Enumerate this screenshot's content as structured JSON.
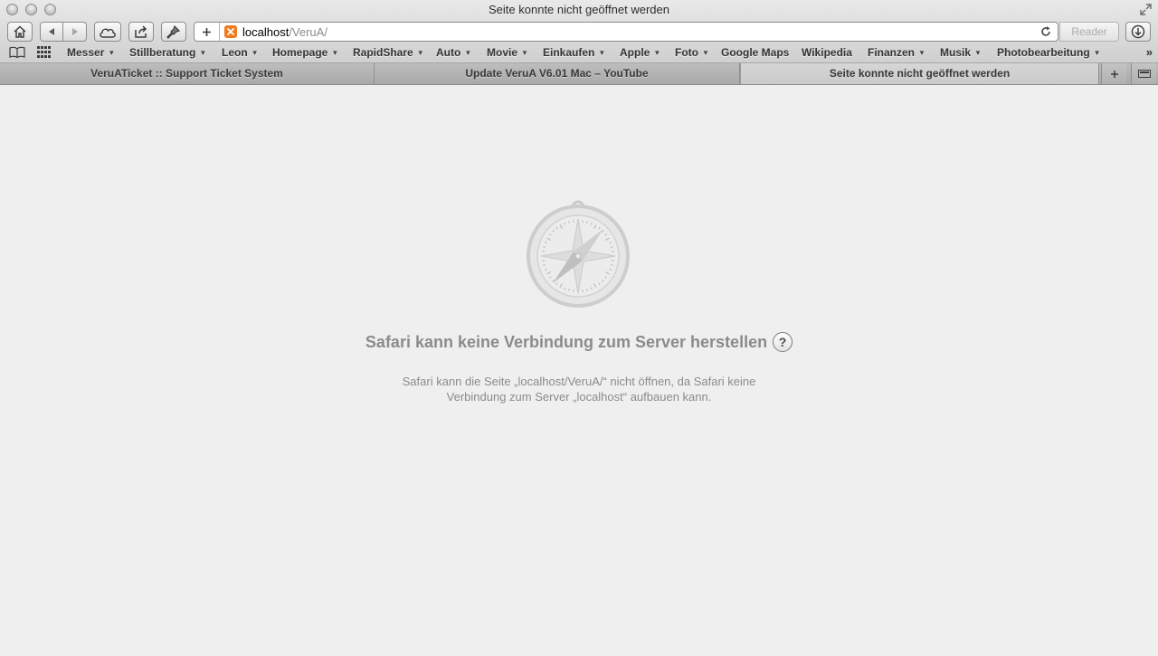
{
  "window": {
    "title": "Seite konnte nicht geöffnet werden"
  },
  "toolbar": {
    "url_host": "localhost",
    "url_path": "/VeruA/",
    "reader_label": "Reader"
  },
  "bookmarks": {
    "items": [
      {
        "label": "Messer",
        "menu": true
      },
      {
        "label": "Stillberatung",
        "menu": true
      },
      {
        "label": "Leon",
        "menu": true
      },
      {
        "label": "Homepage",
        "menu": true
      },
      {
        "label": "RapidShare",
        "menu": true
      },
      {
        "label": "Auto",
        "menu": true
      },
      {
        "label": "Movie",
        "menu": true
      },
      {
        "label": "Einkaufen",
        "menu": true
      },
      {
        "label": "Apple",
        "menu": true
      },
      {
        "label": "Foto",
        "menu": true
      },
      {
        "label": "Google Maps",
        "menu": false
      },
      {
        "label": "Wikipedia",
        "menu": false
      },
      {
        "label": "Finanzen",
        "menu": true
      },
      {
        "label": "Musik",
        "menu": true
      },
      {
        "label": "Photobearbeitung",
        "menu": true
      }
    ],
    "caret": "▼",
    "more": "»"
  },
  "tabs": [
    {
      "label": "VeruATicket :: Support Ticket System",
      "active": false
    },
    {
      "label": "Update VeruA V6.01 Mac – YouTube",
      "active": false
    },
    {
      "label": "Seite konnte nicht geöffnet werden",
      "active": true
    }
  ],
  "error": {
    "title": "Safari kann keine Verbindung zum Server herstellen",
    "help_label": "?",
    "message_line1": "Safari kann die Seite „localhost/VeruA/“ nicht öffnen, da Safari keine",
    "message_line2": "Verbindung zum Server „localhost“ aufbauen kann."
  },
  "colors": {
    "favicon": "#f07a1e",
    "content_bg": "#eeefee",
    "error_text": "#8b8b8b"
  },
  "icons": [
    "home-icon",
    "back-icon",
    "forward-icon",
    "icloud-icon",
    "share-icon",
    "pin-icon",
    "add-icon",
    "reload-icon",
    "download-icon",
    "bookmarks-book-icon",
    "top-sites-icon",
    "safari-compass-icon"
  ]
}
